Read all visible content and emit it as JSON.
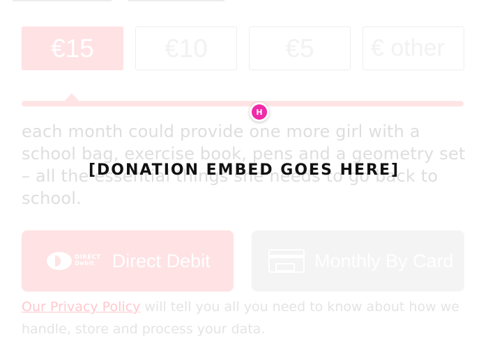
{
  "amounts": [
    {
      "label": "€15",
      "selected": true
    },
    {
      "label": "€10",
      "selected": false
    },
    {
      "label": "€5",
      "selected": false
    },
    {
      "label": "€ other",
      "selected": false
    }
  ],
  "description": "each month could provide one more girl with a school bag, exercise book, pens and a geometry set – all the essential things she needs to go back to school.",
  "payment": {
    "direct_debit": {
      "logo_line1": "DIRECT",
      "logo_line2": "Debit",
      "label": "Direct Debit"
    },
    "card": {
      "label": "Monthly By Card"
    }
  },
  "privacy": {
    "link_text": "Our Privacy Policy",
    "rest_text": " will tell you all you need to know about how we handle, store and process your data."
  },
  "overlay": {
    "embed_label": "[DONATION EMBED GOES HERE]",
    "avatar_initial": "H"
  },
  "colors": {
    "accent_faded": "#ffe2e4",
    "avatar_pink": "#f02aa8"
  }
}
